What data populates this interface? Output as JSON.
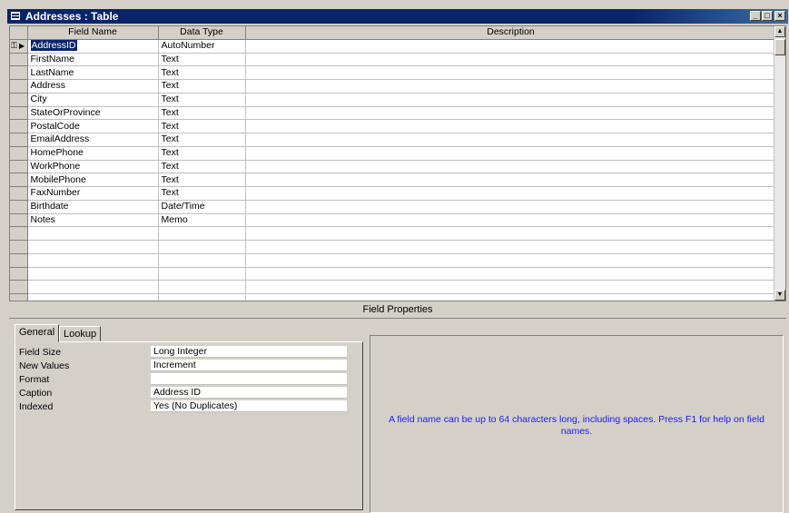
{
  "window": {
    "title": "Addresses : Table",
    "controls": [
      "_",
      "□",
      "×"
    ]
  },
  "grid": {
    "columns": [
      "Field Name",
      "Data Type",
      "Description"
    ],
    "rows": [
      {
        "field": "AddressID",
        "type": "AutoNumber",
        "description": ""
      },
      {
        "field": "FirstName",
        "type": "Text",
        "description": ""
      },
      {
        "field": "LastName",
        "type": "Text",
        "description": ""
      },
      {
        "field": "Address",
        "type": "Text",
        "description": ""
      },
      {
        "field": "City",
        "type": "Text",
        "description": ""
      },
      {
        "field": "StateOrProvince",
        "type": "Text",
        "description": ""
      },
      {
        "field": "PostalCode",
        "type": "Text",
        "description": ""
      },
      {
        "field": "EmailAddress",
        "type": "Text",
        "description": ""
      },
      {
        "field": "HomePhone",
        "type": "Text",
        "description": ""
      },
      {
        "field": "WorkPhone",
        "type": "Text",
        "description": ""
      },
      {
        "field": "MobilePhone",
        "type": "Text",
        "description": ""
      },
      {
        "field": "FaxNumber",
        "type": "Text",
        "description": ""
      },
      {
        "field": "Birthdate",
        "type": "Date/Time",
        "description": ""
      },
      {
        "field": "Notes",
        "type": "Memo",
        "description": ""
      },
      {
        "field": "",
        "type": "",
        "description": ""
      },
      {
        "field": "",
        "type": "",
        "description": ""
      },
      {
        "field": "",
        "type": "",
        "description": ""
      },
      {
        "field": "",
        "type": "",
        "description": ""
      },
      {
        "field": "",
        "type": "",
        "description": ""
      },
      {
        "field": "",
        "type": "",
        "description": ""
      },
      {
        "field": "",
        "type": "",
        "description": ""
      }
    ]
  },
  "field_properties": {
    "label": "Field Properties",
    "tabs": [
      "General",
      "Lookup"
    ],
    "properties": [
      {
        "label": "Field Size",
        "value": "Long Integer"
      },
      {
        "label": "New Values",
        "value": "Increment"
      },
      {
        "label": "Format",
        "value": ""
      },
      {
        "label": "Caption",
        "value": "Address ID"
      },
      {
        "label": "Indexed",
        "value": "Yes (No Duplicates)"
      }
    ],
    "help_text": "A field name can be up to 64 characters long, including spaces.  Press F1 for help on field names."
  },
  "colors": {
    "title_bar": "#0a246a",
    "help_text": "#1a1aff",
    "selection": "#0a246a"
  }
}
